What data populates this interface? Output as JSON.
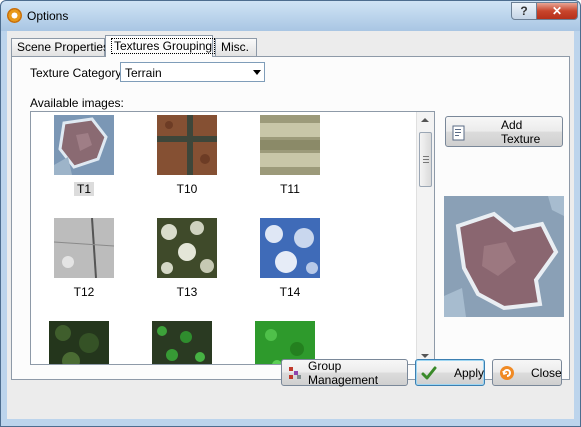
{
  "window": {
    "title": "Options",
    "help_glyph": "?",
    "close_glyph": "✕"
  },
  "tabs": [
    {
      "label": "Scene Properties"
    },
    {
      "label": "Textures Grouping"
    },
    {
      "label": "Misc."
    }
  ],
  "texture_category": {
    "label": "Texture Category:",
    "value": "Terrain"
  },
  "available_images": {
    "label": "Available images:",
    "items": [
      {
        "label": "T1",
        "selected": true
      },
      {
        "label": "T10",
        "selected": false
      },
      {
        "label": "T11",
        "selected": false
      },
      {
        "label": "T12",
        "selected": false
      },
      {
        "label": "T13",
        "selected": false
      },
      {
        "label": "T14",
        "selected": false
      },
      {
        "label": "",
        "selected": false
      },
      {
        "label": "",
        "selected": false
      },
      {
        "label": "",
        "selected": false
      }
    ]
  },
  "buttons": {
    "add_texture": "Add Texture",
    "group_management": "Group Management",
    "apply": "Apply",
    "close": "Close"
  },
  "icons": {
    "app": "gear-sun-icon",
    "add_texture": "document-add-icon",
    "group_management": "group-grid-icon",
    "apply": "checkmark-icon",
    "close": "close-circle-icon"
  },
  "colors": {
    "title_bar": "#a9c6e3",
    "close_button": "#c8452c",
    "apply_focus": "#3c7fb1",
    "selection": "#dcdcdc"
  }
}
